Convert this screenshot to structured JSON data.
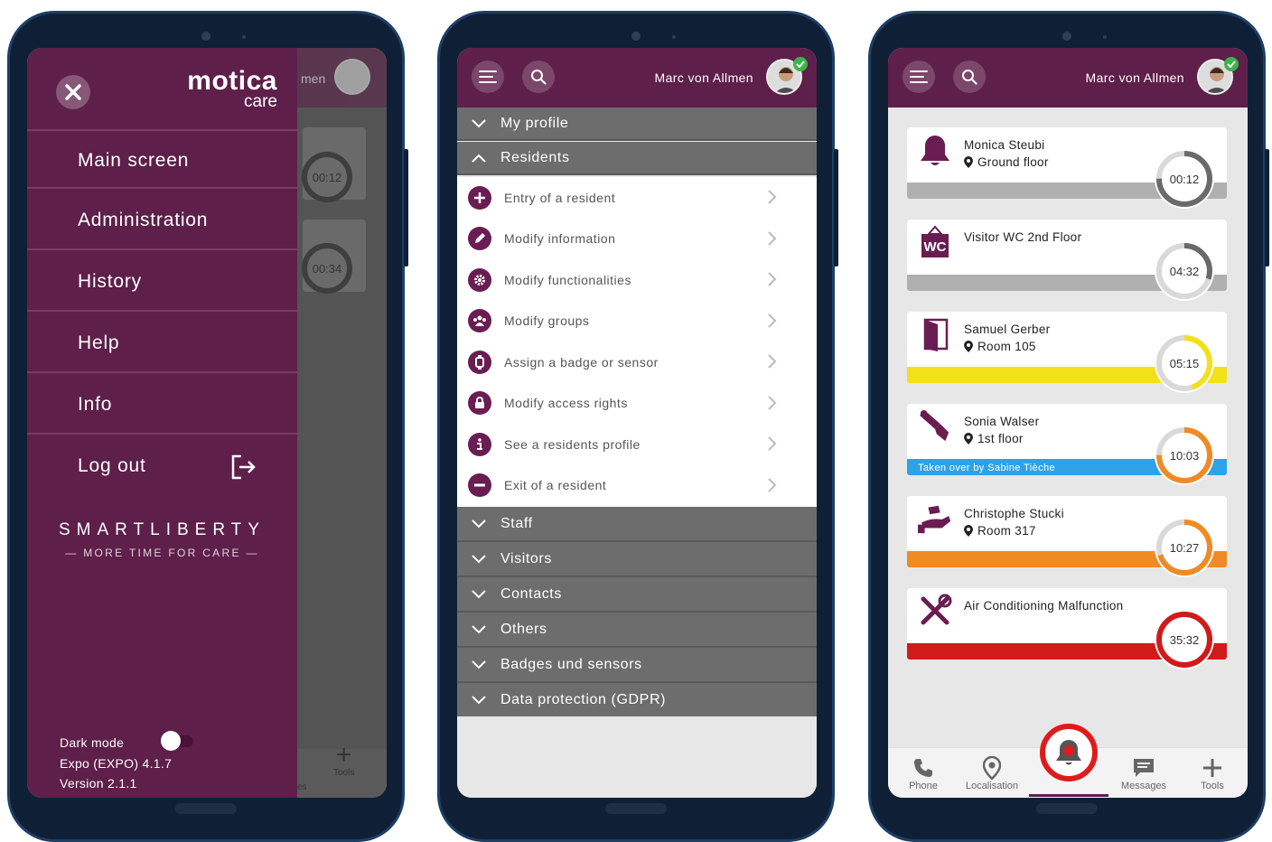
{
  "phones": {
    "menu": {
      "header_partial_name": "men",
      "shadow_timers": [
        "00:12",
        "00:34"
      ],
      "shadow_tab": "Tools",
      "shadow_tab_partial": "es",
      "logo_top": "motica",
      "logo_bottom": "care",
      "items": [
        {
          "label": "Main screen"
        },
        {
          "label": "Administration"
        },
        {
          "label": "History"
        },
        {
          "label": "Help"
        },
        {
          "label": "Info"
        },
        {
          "label": "Log out"
        }
      ],
      "brand": {
        "name": "SMARTLIBERTY",
        "tagline": "MORE TIME FOR CARE"
      },
      "dark_mode_label": "Dark mode",
      "dark_mode_on": false,
      "build": "Expo (EXPO) 4.1.7",
      "version": "Version 2.1.1"
    },
    "admin": {
      "user": "Marc von Allmen",
      "sections_top": [
        {
          "label": "My profile",
          "expanded": false
        },
        {
          "label": "Residents",
          "expanded": true
        }
      ],
      "residents_items": [
        {
          "label": "Entry of a resident",
          "icon": "plus-icon"
        },
        {
          "label": "Modify information",
          "icon": "pencil-icon"
        },
        {
          "label": "Modify functionalities",
          "icon": "gear-icon"
        },
        {
          "label": "Modify groups",
          "icon": "group-icon"
        },
        {
          "label": "Assign a badge or sensor",
          "icon": "watch-icon"
        },
        {
          "label": "Modify access rights",
          "icon": "lock-icon"
        },
        {
          "label": "See a residents profile",
          "icon": "info-icon"
        },
        {
          "label": "Exit of a resident",
          "icon": "minus-icon"
        }
      ],
      "sections_bottom": [
        {
          "label": "Staff"
        },
        {
          "label": "Visitors"
        },
        {
          "label": "Contacts"
        },
        {
          "label": "Others"
        },
        {
          "label": "Badges und sensors"
        },
        {
          "label": "Data protection (GDPR)"
        }
      ]
    },
    "alarms": {
      "user": "Marc von Allmen",
      "cards": [
        {
          "name": "Monica Steubi",
          "location": "Ground floor",
          "timer": "00:12",
          "icon": "bell-icon",
          "color": "#b0b0b0",
          "progress": 0.75,
          "status": ""
        },
        {
          "name": "Visitor WC 2nd Floor",
          "location": "",
          "timer": "04:32",
          "icon": "wc-icon",
          "color": "#b0b0b0",
          "progress": 0.3,
          "status": ""
        },
        {
          "name": "Samuel Gerber",
          "location": "Room 105",
          "timer": "05:15",
          "icon": "door-icon",
          "color": "#f4e01a",
          "progress": 0.45,
          "status": ""
        },
        {
          "name": "Sonia Walser",
          "location": "1st floor",
          "timer": "10:03",
          "icon": "fall-icon",
          "color": "#f08a24",
          "progress": 0.75,
          "status": "Taken over by Sabine Tièche",
          "status_color": "#2ea2e8"
        },
        {
          "name": "Christophe Stucki",
          "location": "Room 317",
          "timer": "10:27",
          "icon": "care-icon",
          "color": "#f08a24",
          "progress": 0.7,
          "status": ""
        },
        {
          "name": "Air Conditioning Malfunction",
          "location": "",
          "timer": "35:32",
          "icon": "tools-icon",
          "color": "#d11a1a",
          "progress": 1.0,
          "status": ""
        }
      ],
      "tabs": [
        {
          "label": "Phone",
          "icon": "phone-icon"
        },
        {
          "label": "Localisation",
          "icon": "pin-icon"
        },
        {
          "label": "",
          "icon": "alarm-icon"
        },
        {
          "label": "Messages",
          "icon": "message-icon"
        },
        {
          "label": "Tools",
          "icon": "plus-icon"
        }
      ]
    }
  }
}
